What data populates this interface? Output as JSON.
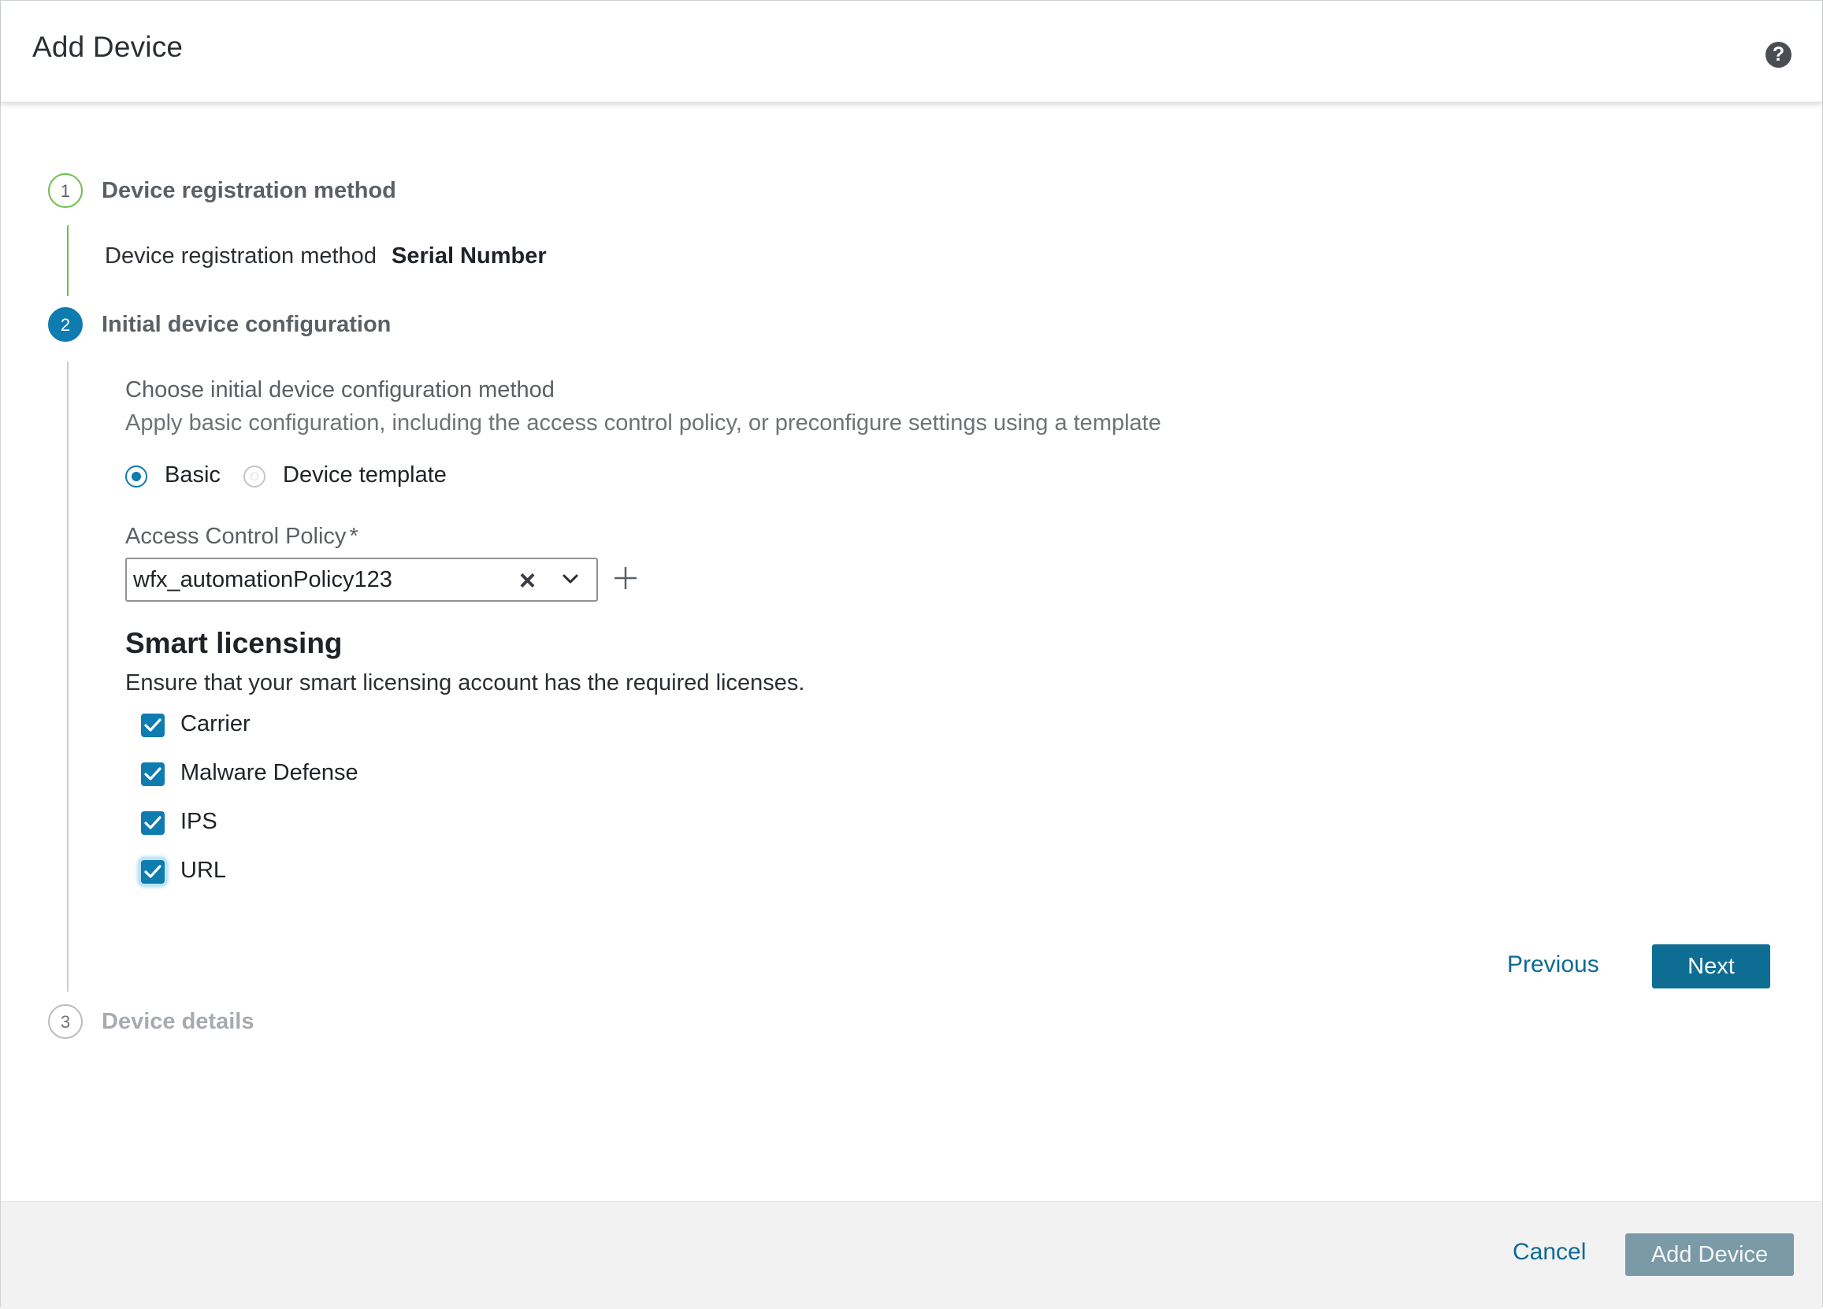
{
  "dialog": {
    "title": "Add Device",
    "help_icon": "help-icon"
  },
  "steps": [
    {
      "number": "1",
      "title": "Device registration method",
      "state": "done"
    },
    {
      "number": "2",
      "title": "Initial device configuration",
      "state": "active"
    },
    {
      "number": "3",
      "title": "Device details",
      "state": "todo"
    }
  ],
  "registration": {
    "label": "Device registration method",
    "value": "Serial Number"
  },
  "config": {
    "heading": "Choose initial device configuration method",
    "description": "Apply basic configuration, including the access control policy, or preconfigure settings using a template",
    "options": [
      {
        "label": "Basic",
        "selected": true
      },
      {
        "label": "Device template",
        "selected": false
      }
    ],
    "acp_label": "Access Control Policy",
    "acp_required": "*",
    "acp_value": "wfx_automationPolicy123"
  },
  "licensing": {
    "title": "Smart licensing",
    "description": "Ensure that your smart licensing account has the required licenses.",
    "items": [
      {
        "label": "Carrier",
        "checked": true
      },
      {
        "label": "Malware Defense",
        "checked": true
      },
      {
        "label": "IPS",
        "checked": true
      },
      {
        "label": "URL",
        "checked": true
      }
    ]
  },
  "nav": {
    "previous": "Previous",
    "next": "Next"
  },
  "footer": {
    "cancel": "Cancel",
    "add": "Add Device"
  },
  "colors": {
    "accent": "#0f7cb0",
    "step_done": "#6cc04a",
    "primary_button": "#0d6d93",
    "disabled_button": "#7a9aa8",
    "link": "#0e6a94"
  }
}
